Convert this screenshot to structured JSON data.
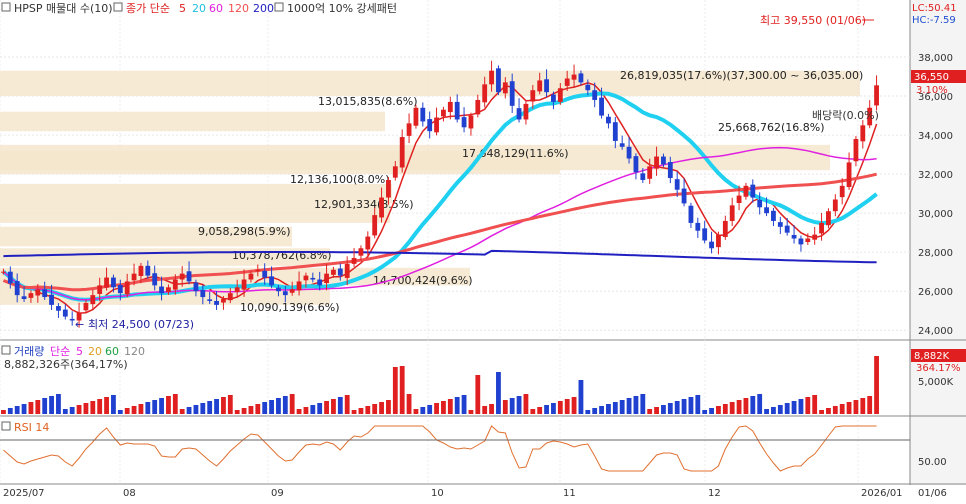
{
  "header": {
    "symbol": "HPSP 매물대 수(10)",
    "ma_label": "종가 단순",
    "ma_periods": [
      "5",
      "20",
      "60",
      "120",
      "200"
    ],
    "pattern_label": "1000억 10% 강세패턴",
    "lc": "LC:50.41",
    "hc": "HC:-7.59"
  },
  "price_panel": {
    "high_annotation": "최고 39,550 (01/06)",
    "low_annotation": "최저 24,500 (07/23)",
    "dividend_label": "배당락(0.0%)",
    "current_price": "36,550",
    "current_change": "3.10%",
    "y_ticks": [
      "38,000",
      "36,000",
      "34,000",
      "32,000",
      "30,000",
      "28,000",
      "26,000",
      "24,000"
    ],
    "zone_labels": [
      "26,819,035(17.6%)(37,300.00 ~ 36,035.00)",
      "13,015,835(8.6%)",
      "17,648,129(11.6%)",
      "25,668,762(16.8%)",
      "12,136,100(8.0%)",
      "12,901,334(8.5%)",
      "9,058,298(5.9%)",
      "10,378,762(6.8%)",
      "14,700,424(9.6%)",
      "10,090,139(6.6%)"
    ]
  },
  "volume_panel": {
    "label": "거래량",
    "ma_label": "단순",
    "ma_periods": [
      "5",
      "20",
      "60",
      "120"
    ],
    "value": "8,882,326주(364,17%)",
    "badge_value": "8,882K",
    "badge_pct": "364.17%",
    "y_tick": "5,000K"
  },
  "rsi_panel": {
    "label": "RSI 14",
    "y_tick": "50.00"
  },
  "x_axis": {
    "ticks": [
      "2025/07",
      "08",
      "09",
      "10",
      "11",
      "12",
      "2026/01"
    ],
    "last_date": "01/06"
  },
  "chart_data": {
    "type": "candlestick",
    "x_labels": [
      "2025/07",
      "08",
      "09",
      "10",
      "11",
      "12",
      "2026/01"
    ],
    "ylim": [
      23500,
      40000
    ],
    "y_ticks": [
      24000,
      26000,
      28000,
      30000,
      32000,
      34000,
      36000,
      38000
    ],
    "candles_close": [
      27000,
      26400,
      25800,
      25600,
      25900,
      26100,
      25700,
      25300,
      25000,
      24700,
      24500,
      24900,
      25400,
      25800,
      26300,
      26700,
      26200,
      25900,
      26500,
      26900,
      27300,
      26800,
      26300,
      25900,
      26200,
      26600,
      26900,
      26500,
      26000,
      25700,
      25500,
      25300,
      25600,
      25900,
      26200,
      26600,
      26900,
      27100,
      26700,
      26300,
      26000,
      25800,
      26100,
      26500,
      26800,
      26600,
      26300,
      26900,
      27100,
      26800,
      27400,
      27700,
      28200,
      28800,
      29900,
      30800,
      31700,
      32400,
      33900,
      34600,
      35400,
      34700,
      34200,
      34900,
      35300,
      35700,
      34800,
      34400,
      35000,
      35800,
      36600,
      37300,
      36200,
      36700,
      35500,
      34800,
      35600,
      36300,
      36800,
      36200,
      35700,
      36400,
      36900,
      37100,
      36700,
      36300,
      35800,
      35000,
      34600,
      33700,
      33400,
      32800,
      32100,
      31700,
      32400,
      32900,
      32500,
      31800,
      31200,
      30500,
      29500,
      29100,
      28600,
      28200,
      28900,
      29600,
      30400,
      30900,
      31400,
      30800,
      30300,
      30000,
      29600,
      29300,
      29000,
      28700,
      28400,
      28700,
      28900,
      29500,
      30100,
      30700,
      31400,
      32600,
      33800,
      34500,
      35400,
      36550
    ],
    "price_range": [
      24500,
      39550
    ],
    "ma_lines": [
      {
        "name": "5",
        "color": "#e02020"
      },
      {
        "name": "20",
        "color": "#20d0f0"
      },
      {
        "name": "60",
        "color": "#e020e0"
      },
      {
        "name": "120",
        "color": "#f05050"
      },
      {
        "name": "200",
        "color": "#2020c0"
      }
    ],
    "volume_peak": 8882326,
    "rsi_reference": 50
  }
}
